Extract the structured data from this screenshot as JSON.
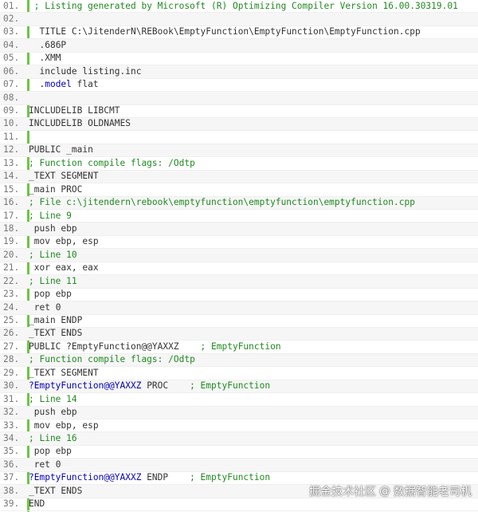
{
  "code": {
    "lines": [
      {
        "num": "01.",
        "prefix": " ",
        "segments": [
          {
            "t": "; Listing generated by Microsoft (R) Optimizing Compiler Version 16.00.30319.01",
            "c": "cm"
          }
        ]
      },
      {
        "num": "02.",
        "prefix": "",
        "segments": []
      },
      {
        "num": "03.",
        "prefix": "  ",
        "segments": [
          {
            "t": "TITLE C:\\JitenderN\\REBook\\EmptyFunction\\EmptyFunction\\EmptyFunction.cpp",
            "c": ""
          }
        ]
      },
      {
        "num": "04.",
        "prefix": "  ",
        "segments": [
          {
            "t": ".686P",
            "c": ""
          }
        ]
      },
      {
        "num": "05.",
        "prefix": "  ",
        "segments": [
          {
            "t": ".XMM",
            "c": ""
          }
        ]
      },
      {
        "num": "06.",
        "prefix": "  ",
        "segments": [
          {
            "t": "include listing.inc",
            "c": ""
          }
        ]
      },
      {
        "num": "07.",
        "prefix": "  ",
        "segments": [
          {
            "t": ".model",
            "c": "kw"
          },
          {
            "t": " flat",
            "c": ""
          }
        ]
      },
      {
        "num": "08.",
        "prefix": "",
        "segments": []
      },
      {
        "num": "09.",
        "prefix": "",
        "segments": [
          {
            "t": "INCLUDELIB LIBCMT",
            "c": ""
          }
        ]
      },
      {
        "num": "10.",
        "prefix": "",
        "segments": [
          {
            "t": "INCLUDELIB OLDNAMES",
            "c": ""
          }
        ]
      },
      {
        "num": "11.",
        "prefix": "",
        "segments": []
      },
      {
        "num": "12.",
        "prefix": "",
        "segments": [
          {
            "t": "PUBLIC _main",
            "c": ""
          }
        ]
      },
      {
        "num": "13.",
        "prefix": "",
        "segments": [
          {
            "t": "; Function compile flags: /Odtp",
            "c": "cm"
          }
        ]
      },
      {
        "num": "14.",
        "prefix": "",
        "segments": [
          {
            "t": "_TEXT SEGMENT",
            "c": ""
          }
        ]
      },
      {
        "num": "15.",
        "prefix": "",
        "segments": [
          {
            "t": "_main PROC",
            "c": ""
          }
        ]
      },
      {
        "num": "16.",
        "prefix": "",
        "segments": [
          {
            "t": "; File c:\\jitendern\\rebook\\emptyfunction\\emptyfunction\\emptyfunction.cpp",
            "c": "cm"
          }
        ]
      },
      {
        "num": "17.",
        "prefix": "",
        "segments": [
          {
            "t": "; Line 9",
            "c": "cm"
          }
        ]
      },
      {
        "num": "18.",
        "prefix": " ",
        "segments": [
          {
            "t": "push ebp",
            "c": ""
          }
        ]
      },
      {
        "num": "19.",
        "prefix": " ",
        "segments": [
          {
            "t": "mov ebp, esp",
            "c": ""
          }
        ]
      },
      {
        "num": "20.",
        "prefix": "",
        "segments": [
          {
            "t": "; Line 10",
            "c": "cm"
          }
        ]
      },
      {
        "num": "21.",
        "prefix": " ",
        "segments": [
          {
            "t": "xor eax, eax",
            "c": ""
          }
        ]
      },
      {
        "num": "22.",
        "prefix": "",
        "segments": [
          {
            "t": "; Line 11",
            "c": "cm"
          }
        ]
      },
      {
        "num": "23.",
        "prefix": " ",
        "segments": [
          {
            "t": "pop ebp",
            "c": ""
          }
        ]
      },
      {
        "num": "24.",
        "prefix": " ",
        "segments": [
          {
            "t": "ret 0",
            "c": ""
          }
        ]
      },
      {
        "num": "25.",
        "prefix": "",
        "segments": [
          {
            "t": "_main ENDP",
            "c": ""
          }
        ]
      },
      {
        "num": "26.",
        "prefix": "",
        "segments": [
          {
            "t": "_TEXT ENDS",
            "c": ""
          }
        ]
      },
      {
        "num": "27.",
        "prefix": "",
        "segments": [
          {
            "t": "PUBLIC ?EmptyFunction@@YAXXZ    ",
            "c": ""
          },
          {
            "t": "; EmptyFunction",
            "c": "cm"
          }
        ]
      },
      {
        "num": "28.",
        "prefix": "",
        "segments": [
          {
            "t": "; Function compile flags: /Odtp",
            "c": "cm"
          }
        ]
      },
      {
        "num": "29.",
        "prefix": "",
        "segments": [
          {
            "t": "_TEXT SEGMENT",
            "c": ""
          }
        ]
      },
      {
        "num": "30.",
        "prefix": "",
        "segments": [
          {
            "t": "?EmptyFunction@@YAXXZ",
            "c": "kw"
          },
          {
            "t": " PROC    ",
            "c": ""
          },
          {
            "t": "; EmptyFunction",
            "c": "cm"
          }
        ]
      },
      {
        "num": "31.",
        "prefix": "",
        "segments": [
          {
            "t": "; Line 14",
            "c": "cm"
          }
        ]
      },
      {
        "num": "32.",
        "prefix": " ",
        "segments": [
          {
            "t": "push ebp",
            "c": ""
          }
        ]
      },
      {
        "num": "33.",
        "prefix": " ",
        "segments": [
          {
            "t": "mov ebp, esp",
            "c": ""
          }
        ]
      },
      {
        "num": "34.",
        "prefix": "",
        "segments": [
          {
            "t": "; Line 16",
            "c": "cm"
          }
        ]
      },
      {
        "num": "35.",
        "prefix": " ",
        "segments": [
          {
            "t": "pop ebp",
            "c": ""
          }
        ]
      },
      {
        "num": "36.",
        "prefix": " ",
        "segments": [
          {
            "t": "ret 0",
            "c": ""
          }
        ]
      },
      {
        "num": "37.",
        "prefix": "",
        "segments": [
          {
            "t": "?EmptyFunction@@YAXXZ",
            "c": "kw"
          },
          {
            "t": " ENDP    ",
            "c": ""
          },
          {
            "t": "; EmptyFunction",
            "c": "cm"
          }
        ]
      },
      {
        "num": "38.",
        "prefix": "",
        "segments": [
          {
            "t": "_TEXT ENDS",
            "c": ""
          }
        ]
      },
      {
        "num": "39.",
        "prefix": "",
        "segments": [
          {
            "t": "END",
            "c": ""
          }
        ]
      }
    ]
  },
  "watermark": {
    "site": "掘金技术社区",
    "at": "@",
    "author": "数据智能老司机"
  },
  "colors": {
    "gutter_bar": "#6cc644",
    "keyword": "#0000b8",
    "comment": "#208a20",
    "text": "#333333",
    "line_number": "#777777"
  }
}
